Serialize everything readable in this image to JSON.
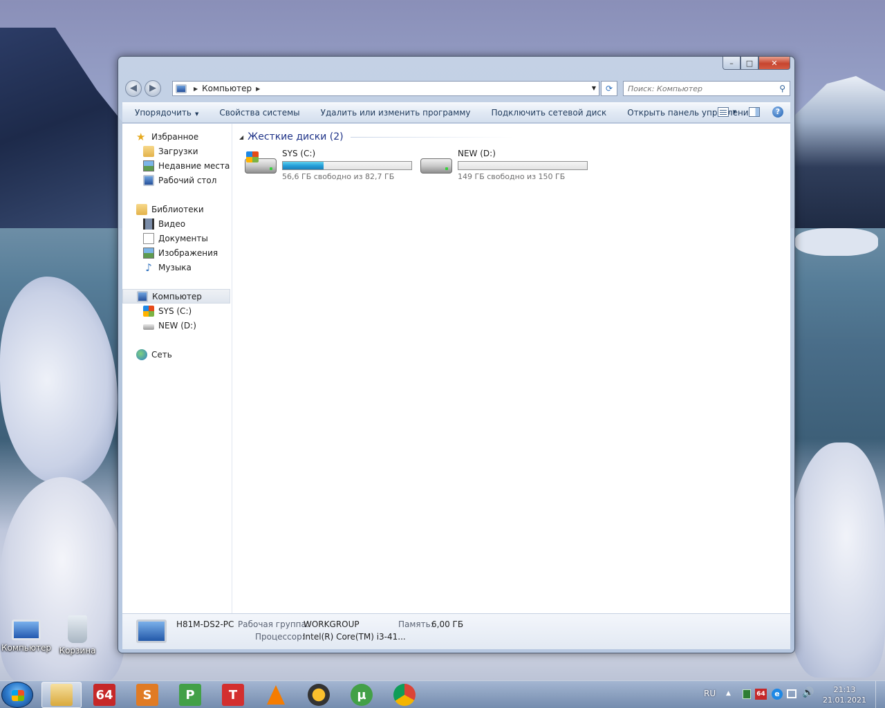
{
  "window": {
    "address": {
      "crumb": "Компьютер"
    },
    "search": {
      "placeholder": "Поиск: Компьютер"
    },
    "caption": {
      "minimize": "–",
      "maximize": "□",
      "close": "✕"
    }
  },
  "toolbar": {
    "organize": "Упорядочить",
    "system_properties": "Свойства системы",
    "uninstall": "Удалить или изменить программу",
    "map_drive": "Подключить сетевой диск",
    "control_panel": "Открыть панель управления",
    "help": "?"
  },
  "sidebar": {
    "favorites": {
      "label": "Избранное",
      "items": [
        "Загрузки",
        "Недавние места",
        "Рабочий стол"
      ]
    },
    "libraries": {
      "label": "Библиотеки",
      "items": [
        "Видео",
        "Документы",
        "Изображения",
        "Музыка"
      ]
    },
    "computer": {
      "label": "Компьютер",
      "items": [
        "SYS (C:)",
        "NEW (D:)"
      ]
    },
    "network": {
      "label": "Сеть"
    }
  },
  "main": {
    "group_title": "Жесткие диски (2)",
    "drives": [
      {
        "name": "SYS (C:)",
        "free_text": "56,6 ГБ свободно из 82,7 ГБ",
        "used_fraction": 0.316
      },
      {
        "name": "NEW (D:)",
        "free_text": "149 ГБ свободно из 150 ГБ",
        "used_fraction": 0.0
      }
    ]
  },
  "details": {
    "pc_name": "H81M-DS2-PC",
    "workgroup_label": "Рабочая группа:",
    "workgroup_value": "WORKGROUP",
    "memory_label": "Память:",
    "memory_value": "6,00 ГБ",
    "cpu_label": "Процессор:",
    "cpu_value": "Intel(R) Core(TM) i3-41..."
  },
  "desktop": {
    "icons": [
      "Компьютер",
      "Корзина"
    ]
  },
  "taskbar": {
    "apps": [
      {
        "icon": "explorer-icon",
        "color": "#e9c46a"
      },
      {
        "icon": "aida64-icon",
        "label": "64",
        "color": "#c62828"
      },
      {
        "icon": "s-app-icon",
        "label": "S",
        "color": "#e07b24"
      },
      {
        "icon": "p-app-icon",
        "label": "P",
        "color": "#43a047"
      },
      {
        "icon": "t-app-icon",
        "label": "T",
        "color": "#d32f2f"
      },
      {
        "icon": "vlc-icon",
        "color": "#f57c00"
      },
      {
        "icon": "aimp-icon",
        "color": "#f9a825"
      },
      {
        "icon": "utorrent-icon",
        "label": "µ",
        "color": "#43a047"
      },
      {
        "icon": "chrome-icon",
        "color": "#4285f4"
      }
    ],
    "tray": {
      "lang": "RU",
      "time": "21:13",
      "date": "21.01.2021"
    }
  }
}
